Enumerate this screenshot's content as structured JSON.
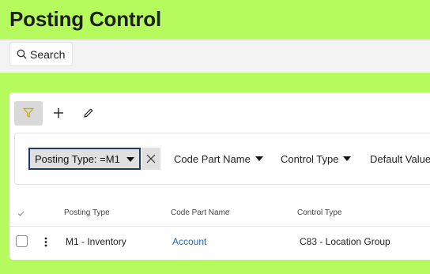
{
  "page": {
    "title": "Posting Control"
  },
  "search": {
    "label": "Search"
  },
  "toolbar": {
    "filter_icon": "filter-icon",
    "add_icon": "plus-icon",
    "edit_icon": "pencil-icon"
  },
  "filters": {
    "active_chip": "Posting Type: =M1",
    "dropdowns": [
      "Code Part Name",
      "Control Type",
      "Default Value"
    ]
  },
  "table": {
    "columns": [
      "Posting Type",
      "Code Part Name",
      "Control Type"
    ],
    "rows": [
      {
        "posting_type": "M1 - Inventory",
        "code_part_name": "Account",
        "control_type": "C83 - Location Group"
      }
    ]
  },
  "colors": {
    "background": "#b6fb5d",
    "link": "#1b6ac9",
    "chip_border": "#1d3a66",
    "filter_icon": "#c9a800"
  }
}
